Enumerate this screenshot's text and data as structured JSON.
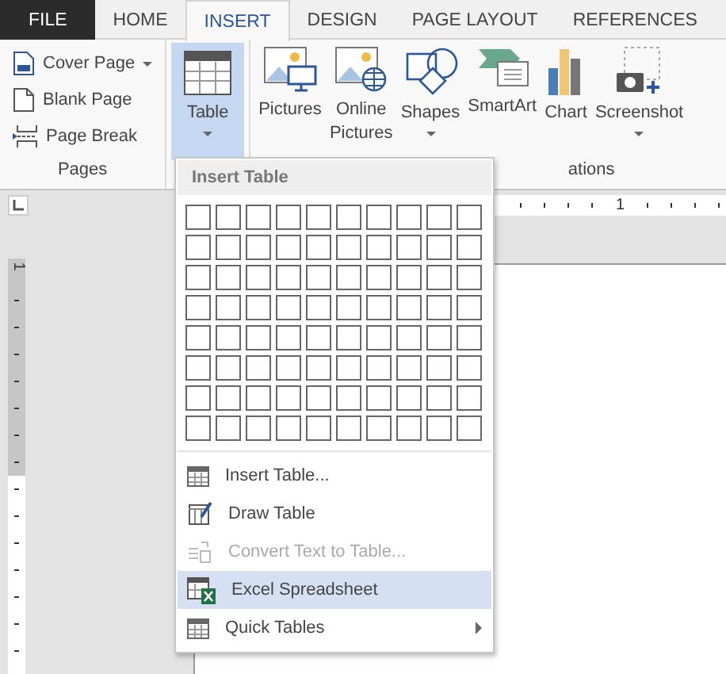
{
  "tabs": [
    {
      "label": "FILE",
      "kind": "file",
      "selected": false
    },
    {
      "label": "HOME",
      "kind": "tab",
      "selected": false
    },
    {
      "label": "INSERT",
      "kind": "tab",
      "selected": true
    },
    {
      "label": "DESIGN",
      "kind": "tab",
      "selected": false
    },
    {
      "label": "PAGE LAYOUT",
      "kind": "tab",
      "selected": false
    },
    {
      "label": "REFERENCES",
      "kind": "tab",
      "selected": false
    }
  ],
  "ribbon": {
    "groups": [
      {
        "label": "Pages",
        "items": [
          {
            "label": "Cover Page",
            "kind": "small",
            "dropdown": true,
            "expanded": false
          },
          {
            "label": "Blank Page",
            "kind": "small",
            "dropdown": false,
            "expanded": false
          },
          {
            "label": "Page Break",
            "kind": "small",
            "dropdown": false,
            "expanded": false
          }
        ]
      },
      {
        "items": [
          {
            "label": "Table",
            "kind": "large",
            "dropdown": true,
            "expanded": true
          }
        ]
      },
      {
        "label": "ations",
        "items": [
          {
            "label": "Pictures",
            "kind": "large",
            "dropdown": false,
            "expanded": false
          },
          {
            "label": "Online Pictures",
            "kind": "large",
            "dropdown": false,
            "expanded": false
          },
          {
            "label": "Shapes",
            "kind": "large",
            "dropdown": true,
            "expanded": false
          },
          {
            "label": "SmartArt",
            "kind": "large",
            "dropdown": false,
            "expanded": false
          },
          {
            "label": "Chart",
            "kind": "large",
            "dropdown": false,
            "expanded": false
          },
          {
            "label": "Screenshot",
            "kind": "large",
            "dropdown": true,
            "expanded": false
          }
        ]
      }
    ]
  },
  "ruler_top": {
    "label": "1"
  },
  "ruler_left": {
    "label": "1"
  },
  "menu": {
    "title": "Insert Table",
    "grid": [
      [
        false,
        false,
        false,
        false,
        false,
        false,
        false,
        false,
        false,
        false
      ],
      [
        false,
        false,
        false,
        false,
        false,
        false,
        false,
        false,
        false,
        false
      ],
      [
        false,
        false,
        false,
        false,
        false,
        false,
        false,
        false,
        false,
        false
      ],
      [
        false,
        false,
        false,
        false,
        false,
        false,
        false,
        false,
        false,
        false
      ],
      [
        false,
        false,
        false,
        false,
        false,
        false,
        false,
        false,
        false,
        false
      ],
      [
        false,
        false,
        false,
        false,
        false,
        false,
        false,
        false,
        false,
        false
      ],
      [
        false,
        false,
        false,
        false,
        false,
        false,
        false,
        false,
        false,
        false
      ],
      [
        false,
        false,
        false,
        false,
        false,
        false,
        false,
        false,
        false,
        false
      ]
    ],
    "items": [
      {
        "label": "Insert Table...",
        "disabled": false,
        "selected": false,
        "submenu": false
      },
      {
        "label": "Draw Table",
        "disabled": false,
        "selected": false,
        "submenu": false
      },
      {
        "label": "Convert Text to Table...",
        "disabled": true,
        "selected": false,
        "submenu": false
      },
      {
        "label": "Excel Spreadsheet",
        "disabled": false,
        "selected": true,
        "submenu": false
      },
      {
        "label": "Quick Tables",
        "disabled": false,
        "selected": false,
        "submenu": true
      }
    ]
  }
}
